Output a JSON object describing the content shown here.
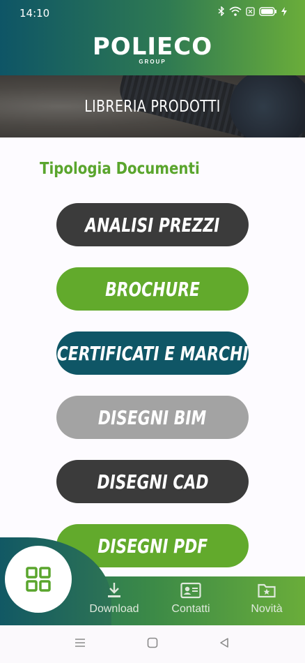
{
  "status_bar": {
    "time": "14:10",
    "icons": [
      "bluetooth-icon",
      "wifi-icon",
      "sim-icon",
      "battery-icon",
      "charging-icon"
    ]
  },
  "header": {
    "logo_text": "POLIECO",
    "logo_subtext": "GROUP"
  },
  "banner": {
    "title": "LIBRERIA PRODOTTI"
  },
  "section": {
    "title": "Tipologia Documenti"
  },
  "documents": [
    {
      "label": "ANALISI PREZZI",
      "color": "#3b3b3b"
    },
    {
      "label": "BROCHURE",
      "color": "#62aa2c"
    },
    {
      "label": "CERTIFICATI E MARCHI",
      "color": "#0f5666"
    },
    {
      "label": "DISEGNI BIM",
      "color": "#a3a3a3"
    },
    {
      "label": "DISEGNI CAD",
      "color": "#3b3b3b"
    },
    {
      "label": "DISEGNI PDF",
      "color": "#62aa2c"
    }
  ],
  "bottom_nav": {
    "home_icon": "grid-icon",
    "items": [
      {
        "label": "Download",
        "icon": "download-icon"
      },
      {
        "label": "Contatti",
        "icon": "contact-card-icon"
      },
      {
        "label": "Novità",
        "icon": "folder-star-icon"
      }
    ]
  },
  "system_nav": {
    "icons": [
      "menu-icon",
      "home-square-icon",
      "back-triangle-icon"
    ]
  },
  "colors": {
    "brand_green": "#62aa2c",
    "brand_teal": "#0f5666",
    "dark": "#3b3b3b",
    "grey": "#a3a3a3"
  }
}
